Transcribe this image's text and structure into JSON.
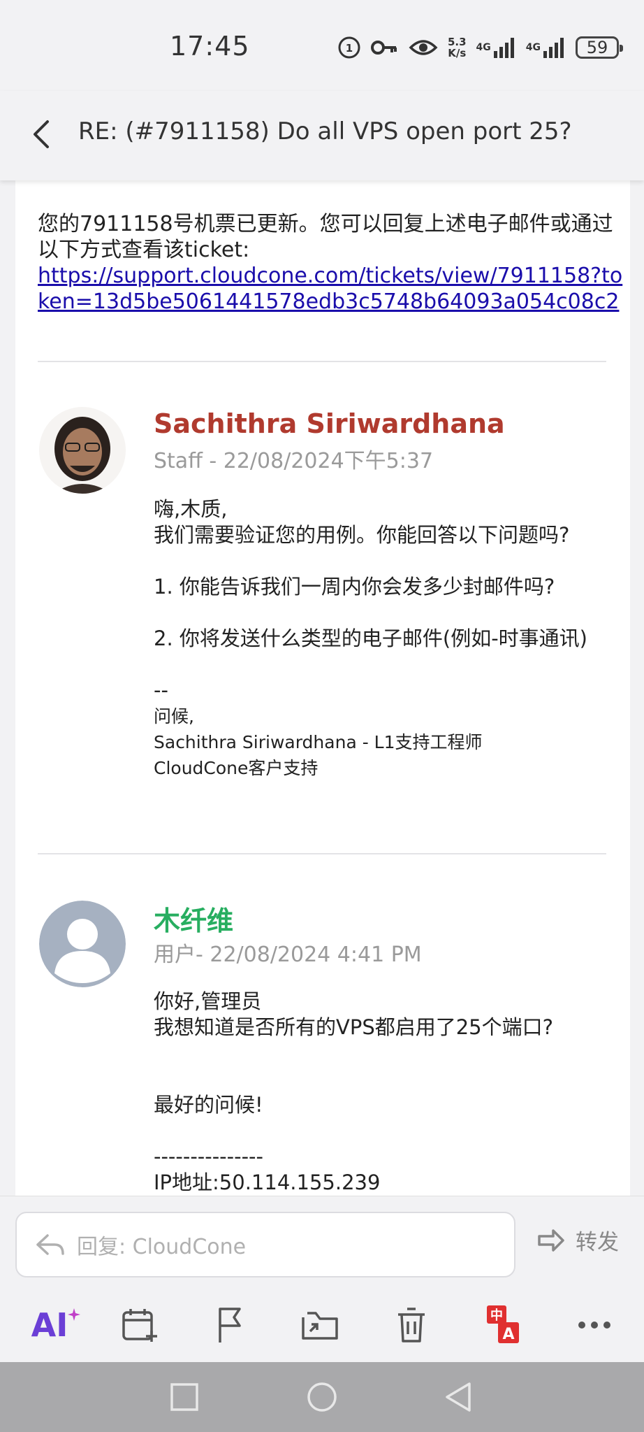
{
  "status": {
    "time": "17:45",
    "speed_value": "5.3",
    "speed_unit": "K/s",
    "net1": "4G",
    "net2": "4G",
    "battery": "59"
  },
  "header": {
    "title": "RE: (#7911158) Do all VPS open port 25?"
  },
  "intro": {
    "text": "您的7911158号机票已更新。您可以回复上述电子邮件或通过以下方式查看该ticket:",
    "link": "https://support.cloudcone.com/tickets/view/7911158?token=13d5be5061441578edb3c5748b64093a054c08c2"
  },
  "messages": [
    {
      "author": "Sachithra Siriwardhana",
      "author_color": "#b03a2e",
      "meta": "Staff - 22/08/2024下午5:37",
      "lines": [
        "嗨,木质,",
        "我们需要验证您的用例。你能回答以下问题吗?",
        "",
        "1. 你能告诉我们一周内你会发多少封邮件吗?",
        "",
        "2. 你将发送什么类型的电子邮件(例如-时事通讯)",
        "",
        "--"
      ],
      "signature": [
        "问候,",
        "Sachithra Siriwardhana - L1支持工程师",
        "CloudCone客户支持"
      ]
    },
    {
      "author": "木纤维",
      "author_color": "#27ae60",
      "meta": "用户- 22/08/2024 4:41 PM",
      "lines": [
        "你好,管理员",
        "我想知道是否所有的VPS都启用了25个端口?",
        "",
        "",
        "最好的问候!",
        "",
        "---------------",
        "IP地址:50.114.155.239"
      ]
    }
  ],
  "reply": {
    "placeholder": "回复:  CloudCone",
    "forward": "转发"
  },
  "toolbar": {
    "ai": "AI",
    "translate_zh": "中",
    "translate_a": "A"
  },
  "icons": {
    "back": "chevron-left-icon",
    "reply": "reply-arrow-icon",
    "forward": "forward-arrow-icon",
    "calendar": "calendar-add-icon",
    "flag": "flag-icon",
    "move": "folder-move-icon",
    "delete": "trash-icon",
    "translate": "translate-icon",
    "more": "more-icon"
  },
  "colors": {
    "ai": "#6b3fd6",
    "link": "#1a0dab",
    "translate": "#e03030"
  }
}
